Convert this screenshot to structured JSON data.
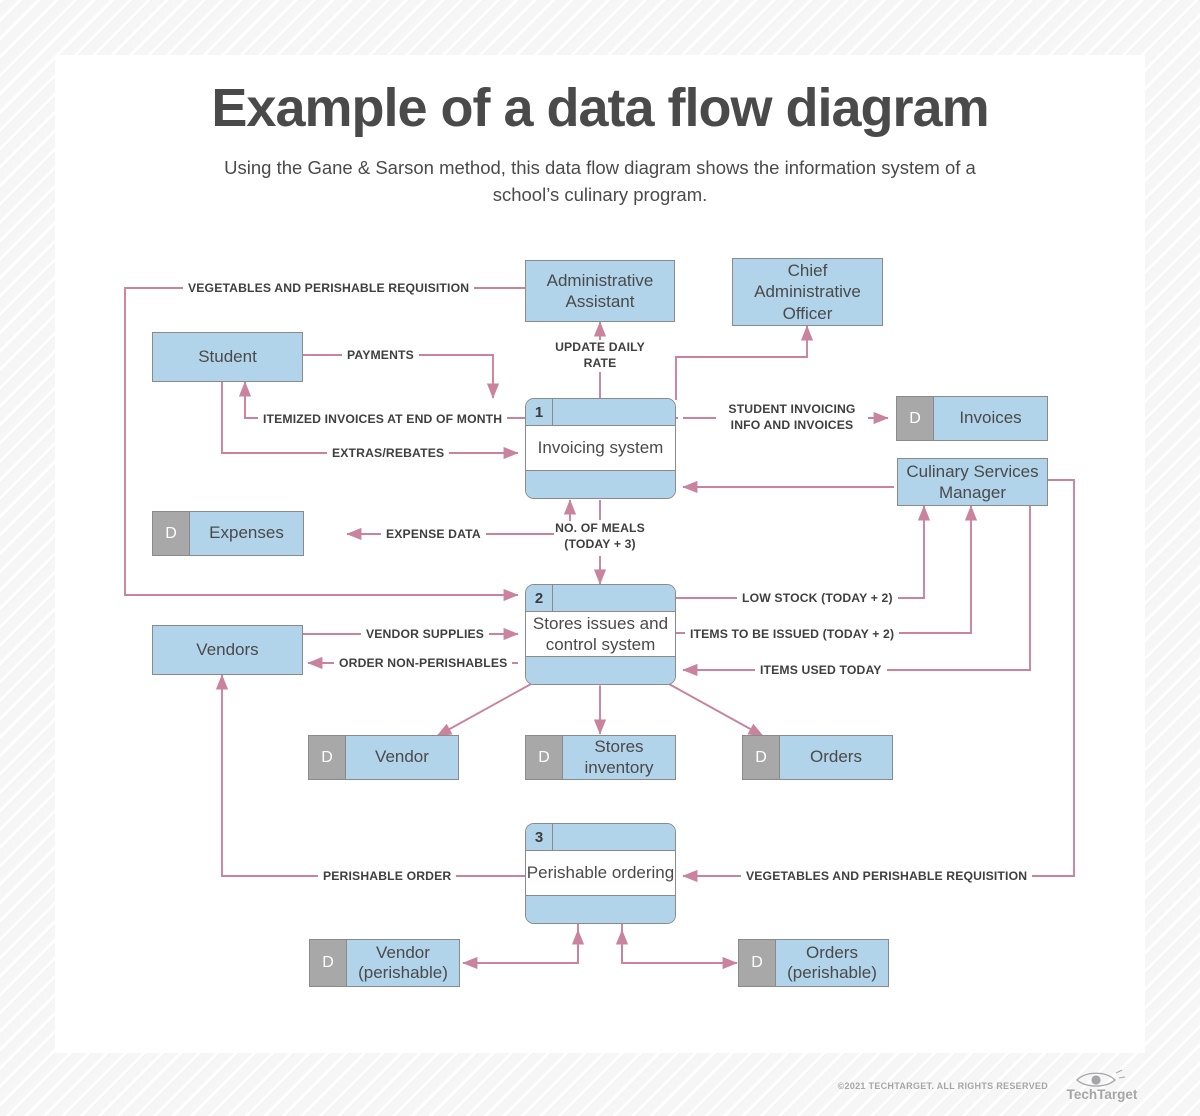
{
  "header": {
    "title": "Example of a data flow diagram",
    "subtitle": "Using the Gane & Sarson method, this data flow diagram shows the information system of a school’s culinary program."
  },
  "colors": {
    "fill_blue": "#b2d4ea",
    "store_gray": "#a8a8a8",
    "border_gray": "#8a8a8a",
    "arrow_pink": "#c9839c",
    "text_gray": "#4a4a4a",
    "page_bg": "#f4f4f5"
  },
  "diagram": {
    "type": "data-flow-diagram",
    "notation": "Gane & Sarson",
    "entities": [
      {
        "id": "admin_assistant",
        "label": "Administrative Assistant"
      },
      {
        "id": "chief_admin_officer",
        "label": "Chief Administrative Officer"
      },
      {
        "id": "student",
        "label": "Student"
      },
      {
        "id": "culinary_manager",
        "label": "Culinary Services Manager"
      },
      {
        "id": "vendors",
        "label": "Vendors"
      }
    ],
    "processes": [
      {
        "id": "p1",
        "number": "1",
        "label": "Invoicing system"
      },
      {
        "id": "p2",
        "number": "2",
        "label": "Stores issues and control system"
      },
      {
        "id": "p3",
        "number": "3",
        "label": "Perishable ordering"
      }
    ],
    "data_stores": [
      {
        "id": "ds_invoices",
        "marker": "D",
        "label": "Invoices"
      },
      {
        "id": "ds_expenses",
        "marker": "D",
        "label": "Expenses"
      },
      {
        "id": "ds_vendor",
        "marker": "D",
        "label": "Vendor"
      },
      {
        "id": "ds_stores_inventory",
        "marker": "D",
        "label": "Stores inventory"
      },
      {
        "id": "ds_orders",
        "marker": "D",
        "label": "Orders"
      },
      {
        "id": "ds_vendor_perishable",
        "marker": "D",
        "label": "Vendor (perishable)"
      },
      {
        "id": "ds_orders_perishable",
        "marker": "D",
        "label": "Orders (perishable)"
      }
    ],
    "flows": [
      {
        "id": "f_veg_top",
        "label": "VEGETABLES AND PERISHABLE REQUISITION",
        "from": "admin_assistant",
        "to": "p2"
      },
      {
        "id": "f_payments",
        "label": "PAYMENTS",
        "from": "student",
        "to": "p1"
      },
      {
        "id": "f_update_rate",
        "label": "UPDATE DAILY RATE",
        "from": "p1",
        "to": "admin_assistant"
      },
      {
        "id": "f_itemized",
        "label": "ITEMIZED INVOICES AT END OF MONTH",
        "from": "p1",
        "to": "student"
      },
      {
        "id": "f_extras",
        "label": "EXTRAS/REBATES",
        "from": "student",
        "to": "p1"
      },
      {
        "id": "f_student_invoicing",
        "label": "STUDENT INVOICING INFO AND INVOICES",
        "from": "p1",
        "to": "ds_invoices"
      },
      {
        "id": "f_expense_data",
        "label": "EXPENSE DATA",
        "from": "p1",
        "to": "ds_expenses"
      },
      {
        "id": "f_no_meals",
        "label": "NO. OF MEALS (TODAY + 3)",
        "from": "p1",
        "to": "p2"
      },
      {
        "id": "f_low_stock",
        "label": "LOW STOCK (TODAY + 2)",
        "from": "p2",
        "to": "culinary_manager"
      },
      {
        "id": "f_items_issued",
        "label": "ITEMS TO BE ISSUED (TODAY + 2)",
        "from": "p2",
        "to": "culinary_manager"
      },
      {
        "id": "f_items_used",
        "label": "ITEMS USED TODAY",
        "from": "culinary_manager",
        "to": "p2"
      },
      {
        "id": "f_vendor_supplies",
        "label": "VENDOR SUPPLIES",
        "from": "vendors",
        "to": "p2"
      },
      {
        "id": "f_order_nonperish",
        "label": "ORDER NON-PERISHABLES",
        "from": "p2",
        "to": "vendors"
      },
      {
        "id": "f_perishable_order",
        "label": "PERISHABLE ORDER",
        "from": "p3",
        "to": "vendors"
      },
      {
        "id": "f_veg_bottom",
        "label": "VEGETABLES AND PERISHABLE REQUISITION",
        "from": "culinary_manager",
        "to": "p3"
      }
    ]
  },
  "footer": {
    "copyright": "©2021 TECHTARGET. ALL RIGHTS RESERVED",
    "brand": "TechTarget"
  }
}
